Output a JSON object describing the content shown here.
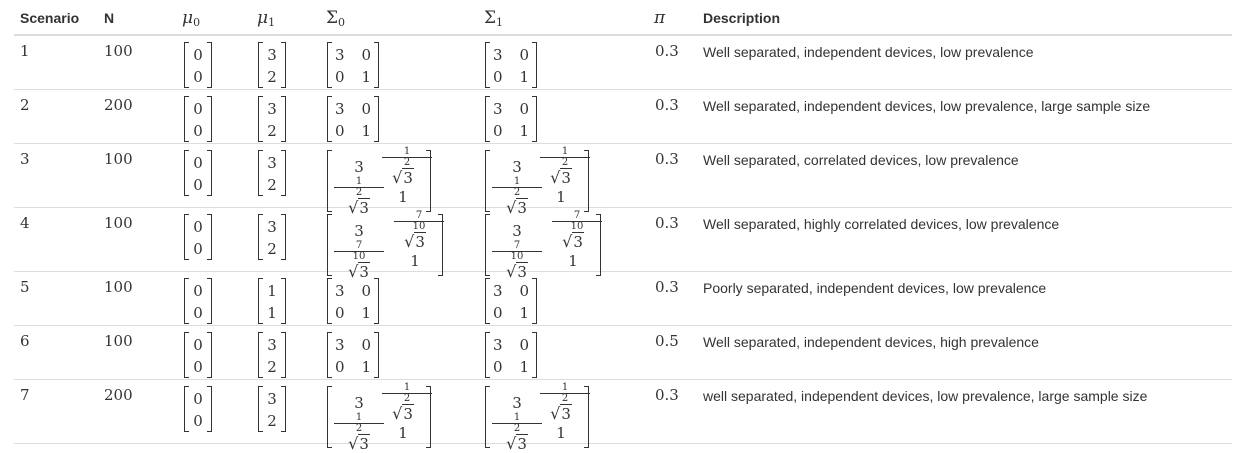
{
  "header": {
    "scenario": "Scenario",
    "n": "N",
    "mu": "μ",
    "sigma": "Σ",
    "pi": "π",
    "description": "Description"
  },
  "rows": [
    {
      "scenario": "1",
      "n": "100",
      "mu0": [
        "0",
        "0"
      ],
      "mu1": [
        "3",
        "2"
      ],
      "sigma0": [
        [
          "3",
          "0"
        ],
        [
          "0",
          "1"
        ]
      ],
      "sigma1": [
        [
          "3",
          "0"
        ],
        [
          "0",
          "1"
        ]
      ],
      "pi": "0.3",
      "description": "Well separated, independent devices, low prevalence"
    },
    {
      "scenario": "2",
      "n": "200",
      "mu0": [
        "0",
        "0"
      ],
      "mu1": [
        "3",
        "2"
      ],
      "sigma0": [
        [
          "3",
          "0"
        ],
        [
          "0",
          "1"
        ]
      ],
      "sigma1": [
        [
          "3",
          "0"
        ],
        [
          "0",
          "1"
        ]
      ],
      "pi": "0.3",
      "description": "Well separated, independent devices, low prevalence, large sample size"
    },
    {
      "scenario": "3",
      "n": "100",
      "mu0": [
        "0",
        "0"
      ],
      "mu1": [
        "3",
        "2"
      ],
      "sigma0": [
        [
          "3",
          "1/2 √3"
        ],
        [
          "1/2 √3",
          "1"
        ]
      ],
      "sigma1": [
        [
          "3",
          "1/2 √3"
        ],
        [
          "1/2 √3",
          "1"
        ]
      ],
      "pi": "0.3",
      "description": "Well separated, correlated devices, low prevalence"
    },
    {
      "scenario": "4",
      "n": "100",
      "mu0": [
        "0",
        "0"
      ],
      "mu1": [
        "3",
        "2"
      ],
      "sigma0": [
        [
          "3",
          "7/10 √3"
        ],
        [
          "7/10 √3",
          "1"
        ]
      ],
      "sigma1": [
        [
          "3",
          "7/10 √3"
        ],
        [
          "7/10 √3",
          "1"
        ]
      ],
      "pi": "0.3",
      "description": "Well separated, highly correlated devices, low prevalence"
    },
    {
      "scenario": "5",
      "n": "100",
      "mu0": [
        "0",
        "0"
      ],
      "mu1": [
        "1",
        "1"
      ],
      "sigma0": [
        [
          "3",
          "0"
        ],
        [
          "0",
          "1"
        ]
      ],
      "sigma1": [
        [
          "3",
          "0"
        ],
        [
          "0",
          "1"
        ]
      ],
      "pi": "0.3",
      "description": "Poorly separated, independent devices, low prevalence"
    },
    {
      "scenario": "6",
      "n": "100",
      "mu0": [
        "0",
        "0"
      ],
      "mu1": [
        "3",
        "2"
      ],
      "sigma0": [
        [
          "3",
          "0"
        ],
        [
          "0",
          "1"
        ]
      ],
      "sigma1": [
        [
          "3",
          "0"
        ],
        [
          "0",
          "1"
        ]
      ],
      "pi": "0.5",
      "description": "Well separated, independent devices, high prevalence"
    },
    {
      "scenario": "7",
      "n": "200",
      "mu0": [
        "0",
        "0"
      ],
      "mu1": [
        "3",
        "2"
      ],
      "sigma0": [
        [
          "3",
          "1/2 √3"
        ],
        [
          "1/2 √3",
          "1"
        ]
      ],
      "sigma1": [
        [
          "3",
          "1/2 √3"
        ],
        [
          "1/2 √3",
          "1"
        ]
      ],
      "pi": "0.3",
      "description": "well separated, independent devices, low prevalence, large sample size"
    }
  ]
}
